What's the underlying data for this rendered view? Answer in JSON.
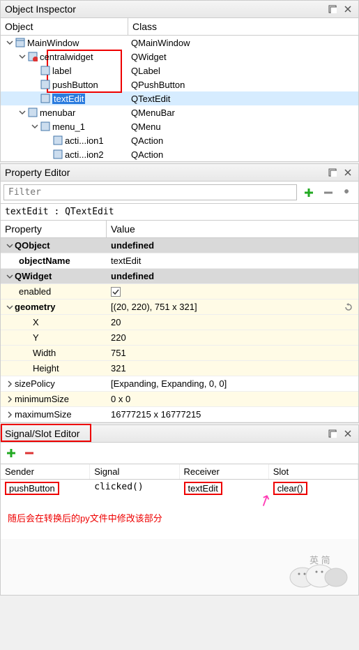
{
  "objectInspector": {
    "title": "Object Inspector",
    "columns": {
      "object": "Object",
      "class": "Class"
    },
    "rows": [
      {
        "indent": 0,
        "arrow": "down",
        "icon": "window",
        "name": "MainWindow",
        "class": "QMainWindow"
      },
      {
        "indent": 1,
        "arrow": "down",
        "icon": "widget-red",
        "name": "centralwidget",
        "class": "QWidget"
      },
      {
        "indent": 2,
        "arrow": "",
        "icon": "widget",
        "name": "label",
        "class": "QLabel"
      },
      {
        "indent": 2,
        "arrow": "",
        "icon": "widget",
        "name": "pushButton",
        "class": "QPushButton"
      },
      {
        "indent": 2,
        "arrow": "",
        "icon": "widget",
        "name": "textEdit",
        "class": "QTextEdit",
        "selected": true
      },
      {
        "indent": 1,
        "arrow": "down",
        "icon": "widget",
        "name": "menubar",
        "class": "QMenuBar"
      },
      {
        "indent": 2,
        "arrow": "down",
        "icon": "widget",
        "name": "menu_1",
        "class": "QMenu"
      },
      {
        "indent": 3,
        "arrow": "",
        "icon": "widget",
        "name": "acti...ion1",
        "class": "QAction"
      },
      {
        "indent": 3,
        "arrow": "",
        "icon": "widget",
        "name": "acti...ion2",
        "class": "QAction"
      }
    ]
  },
  "propertyEditor": {
    "title": "Property Editor",
    "filterPlaceholder": "Filter",
    "context": "textEdit : QTextEdit",
    "columns": {
      "property": "Property",
      "value": "Value"
    },
    "rows": [
      {
        "type": "group",
        "arrow": "down",
        "name": "QObject"
      },
      {
        "type": "prop",
        "bold": true,
        "indent": 1,
        "name": "objectName",
        "value": "textEdit"
      },
      {
        "type": "group",
        "arrow": "down",
        "name": "QWidget"
      },
      {
        "type": "prop",
        "yellow": true,
        "indent": 1,
        "name": "enabled",
        "value": "",
        "checkbox": true,
        "checked": true
      },
      {
        "type": "prop",
        "yellow": true,
        "bold": true,
        "arrow": "down",
        "indent": 0,
        "name": "geometry",
        "value": "[(20, 220), 751 x 321]",
        "reset": true
      },
      {
        "type": "prop",
        "yellow": true,
        "indent": 2,
        "name": "X",
        "value": "20"
      },
      {
        "type": "prop",
        "yellow": true,
        "indent": 2,
        "name": "Y",
        "value": "220"
      },
      {
        "type": "prop",
        "yellow": true,
        "indent": 2,
        "name": "Width",
        "value": "751"
      },
      {
        "type": "prop",
        "yellow": true,
        "indent": 2,
        "name": "Height",
        "value": "321"
      },
      {
        "type": "prop",
        "arrow": "right",
        "indent": 0,
        "name": "sizePolicy",
        "value": "[Expanding, Expanding, 0, 0]"
      },
      {
        "type": "prop",
        "yellow": true,
        "arrow": "right",
        "indent": 0,
        "name": "minimumSize",
        "value": "0 x 0"
      },
      {
        "type": "prop",
        "arrow": "right",
        "indent": 0,
        "name": "maximumSize",
        "value": "16777215 x 16777215"
      }
    ]
  },
  "signalSlot": {
    "title": "Signal/Slot Editor",
    "columns": {
      "sender": "Sender",
      "signal": "Signal",
      "receiver": "Receiver",
      "slot": "Slot"
    },
    "row": {
      "sender": "pushButton",
      "signal": "clicked()",
      "receiver": "textEdit",
      "slot": "clear()"
    }
  },
  "annotation": "随后会在转换后的py文件中修改该部分",
  "watermark": "英 简"
}
